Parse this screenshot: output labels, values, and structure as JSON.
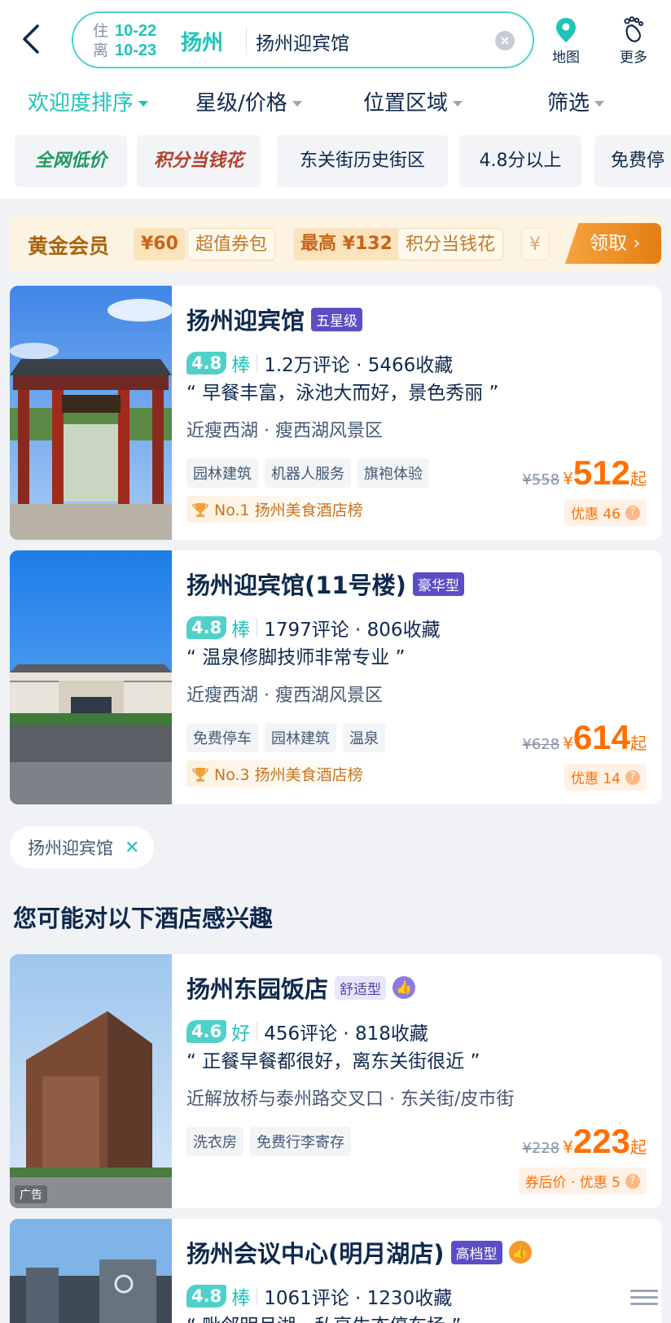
{
  "header": {
    "checkin_label": "住",
    "checkin_date": "10-22",
    "checkout_label": "离",
    "checkout_date": "10-23",
    "city": "扬州",
    "keyword": "扬州迎宾馆",
    "map_label": "地图",
    "more_label": "更多"
  },
  "sort_bar": {
    "items": [
      "欢迎度排序",
      "星级/价格",
      "位置区域",
      "筛选"
    ]
  },
  "filter_chips": [
    "全网低价",
    "积分当钱花",
    "东关街历史街区",
    "4.8分以上",
    "免费停"
  ],
  "gold_member": {
    "title": "黄金会员",
    "pills": [
      "¥60",
      "超值券包",
      "最高 ¥132",
      "积分当钱花",
      "¥"
    ],
    "claim_label": "领取 ›"
  },
  "hotels": [
    {
      "name": "扬州迎宾馆",
      "badge": "五星级",
      "score": "4.8",
      "score_label": "棒",
      "counts": "1.2万评论 · 5466收藏",
      "quote": "“ 早餐丰富，泳池大而好，景色秀丽 ”",
      "location": "近瘦西湖 · 瘦西湖风景区",
      "tags": [
        "园林建筑",
        "机器人服务",
        "旗袍体验"
      ],
      "rank": "No.1 扬州美食酒店榜",
      "orig_price": "¥558",
      "yen": "¥",
      "price": "512",
      "price_suffix": "起",
      "discount": "优惠 46"
    },
    {
      "name": "扬州迎宾馆(11号楼)",
      "badge": "豪华型",
      "score": "4.8",
      "score_label": "棒",
      "counts": "1797评论 · 806收藏",
      "quote": "“ 温泉修脚技师非常专业 ”",
      "location": "近瘦西湖 · 瘦西湖风景区",
      "tags": [
        "免费停车",
        "园林建筑",
        "温泉"
      ],
      "rank": "No.3 扬州美食酒店榜",
      "orig_price": "¥628",
      "yen": "¥",
      "price": "614",
      "price_suffix": "起",
      "discount": "优惠 14"
    },
    {
      "name": "扬州东园饭店",
      "badge": "舒适型",
      "score": "4.6",
      "score_label": "好",
      "counts": "456评论 · 818收藏",
      "quote": "“ 正餐早餐都很好，离东关街很近 ”",
      "location": "近解放桥与泰州路交叉口 · 东关街/皮市街",
      "tags": [
        "洗衣房",
        "免费行李寄存"
      ],
      "orig_price": "¥228",
      "yen": "¥",
      "price": "223",
      "price_suffix": "起",
      "discount": "券后价 · 优惠 5",
      "ad_label": "广告"
    },
    {
      "name": "扬州会议中心(明月湖店)",
      "badge": "高档型",
      "score": "4.8",
      "score_label": "棒",
      "counts": "1061评论 · 1230收藏",
      "quote": "“ 毗邻明月湖，私享生态停车场 ”"
    }
  ],
  "keyword_chip": "扬州迎宾馆",
  "section_title": "您可能对以下酒店感兴趣"
}
